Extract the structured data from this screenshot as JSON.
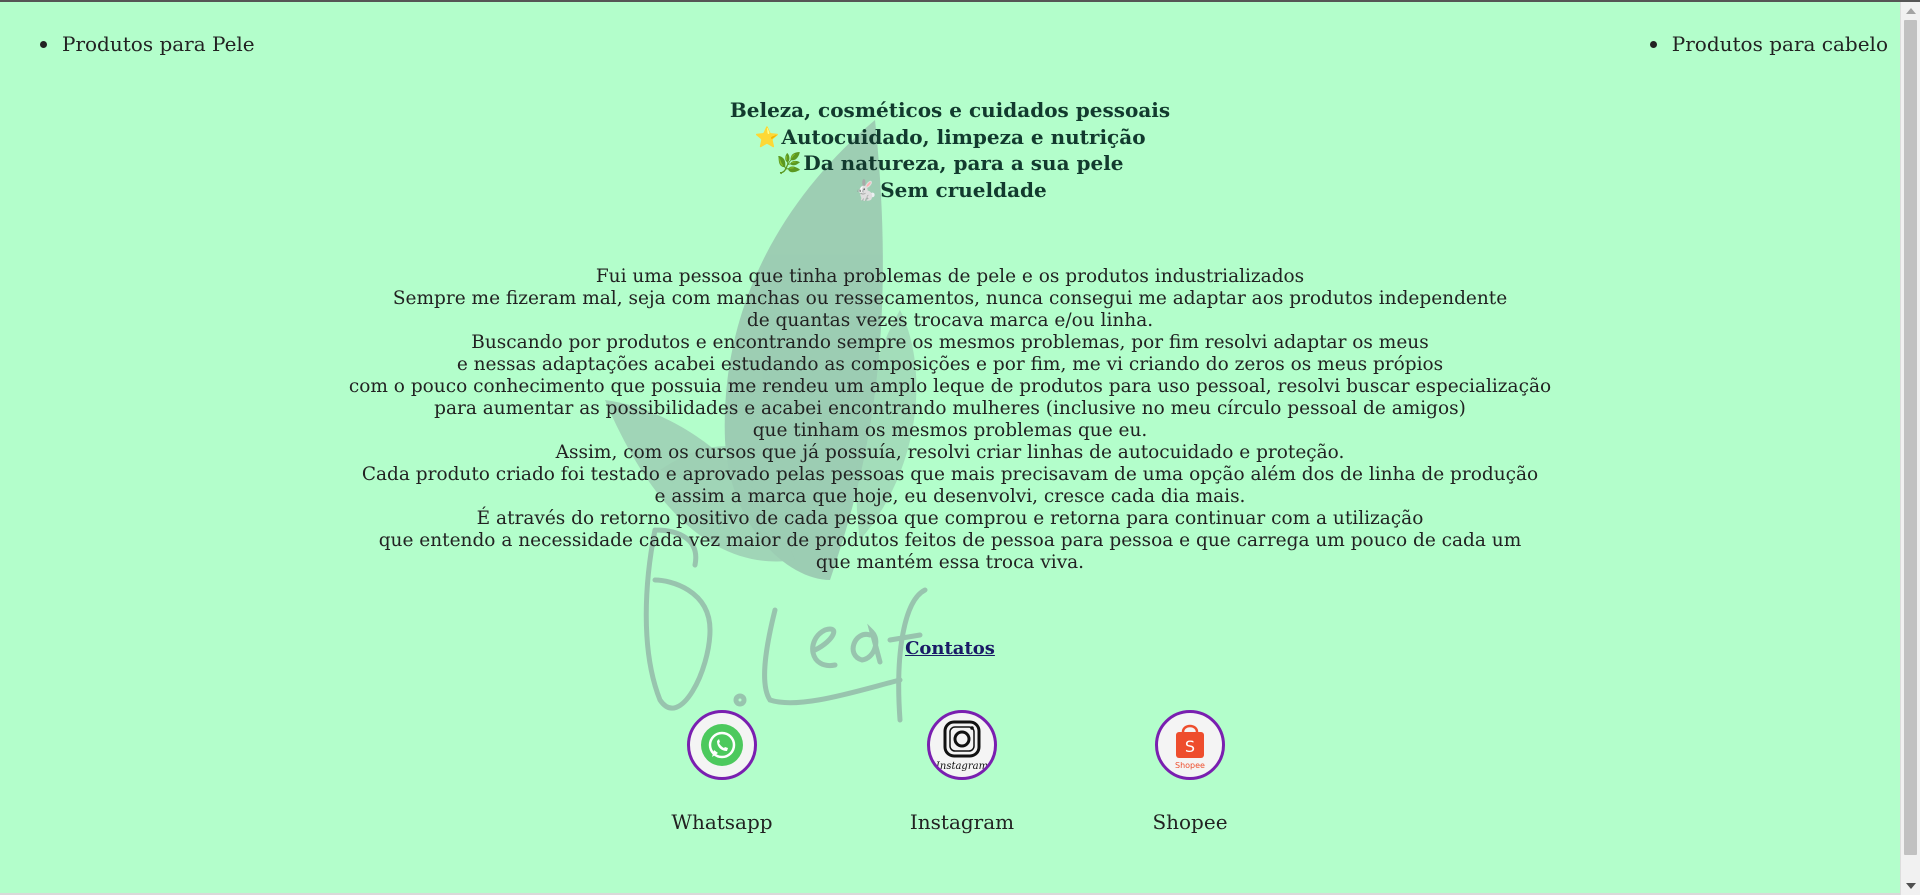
{
  "nav": {
    "left": "Produtos para Pele",
    "right": "Produtos para cabelo"
  },
  "headings": [
    {
      "emoji": "",
      "text": "Beleza, cosméticos e cuidados pessoais"
    },
    {
      "emoji": "⭐",
      "text": "Autocuidado, limpeza e nutrição"
    },
    {
      "emoji": "🌿",
      "text": "Da natureza, para a sua pele"
    },
    {
      "emoji": "🐇",
      "text": "Sem crueldade"
    }
  ],
  "story": [
    "Fui uma pessoa que tinha problemas de pele e os produtos industrializados",
    "Sempre me fizeram mal, seja com manchas ou ressecamentos, nunca consegui me adaptar aos produtos independente",
    "de quantas vezes trocava marca e/ou linha.",
    "Buscando por produtos e encontrando sempre os mesmos problemas, por fim resolvi adaptar os meus",
    "e nessas adaptações acabei estudando as composições e por fim, me vi criando do zeros os meus própios",
    "com o pouco conhecimento que possuia me rendeu um amplo leque de produtos para uso pessoal, resolvi buscar especialização",
    "para aumentar as possibilidades e acabei encontrando mulheres (inclusive no meu círculo pessoal de amigos)",
    "que tinham os mesmos problemas que eu.",
    "Assim, com os cursos que já possuía, resolvi criar linhas de autocuidado e proteção.",
    "Cada produto criado foi testado e aprovado pelas pessoas que mais precisavam de uma opção além dos de linha de produção",
    "e assim a marca que hoje, eu desenvolvi, cresce cada dia mais.",
    "É através do retorno positivo de cada pessoa que comprou e retorna para continuar com a utilização",
    "que entendo a necessidade cada vez maior de produtos feitos de pessoa para pessoa e que carrega um pouco de cada um",
    "que mantém essa troca viva."
  ],
  "contacts": {
    "title": "Contatos"
  },
  "social": [
    {
      "name": "Whatsapp",
      "icon": "whatsapp-icon"
    },
    {
      "name": "Instagram",
      "icon": "instagram-icon",
      "logo_text": "Instagram"
    },
    {
      "name": "Shopee",
      "icon": "shopee-icon",
      "logo_text": "Shopee"
    }
  ],
  "watermark": {
    "logo_text": "B. Leaf"
  },
  "colors": {
    "background": "#b3fecb",
    "heading": "#123a2e",
    "link": "#1a1a66",
    "social_border": "#7a1fb0",
    "whatsapp": "#4cc95d",
    "shopee": "#ee4d2d"
  }
}
